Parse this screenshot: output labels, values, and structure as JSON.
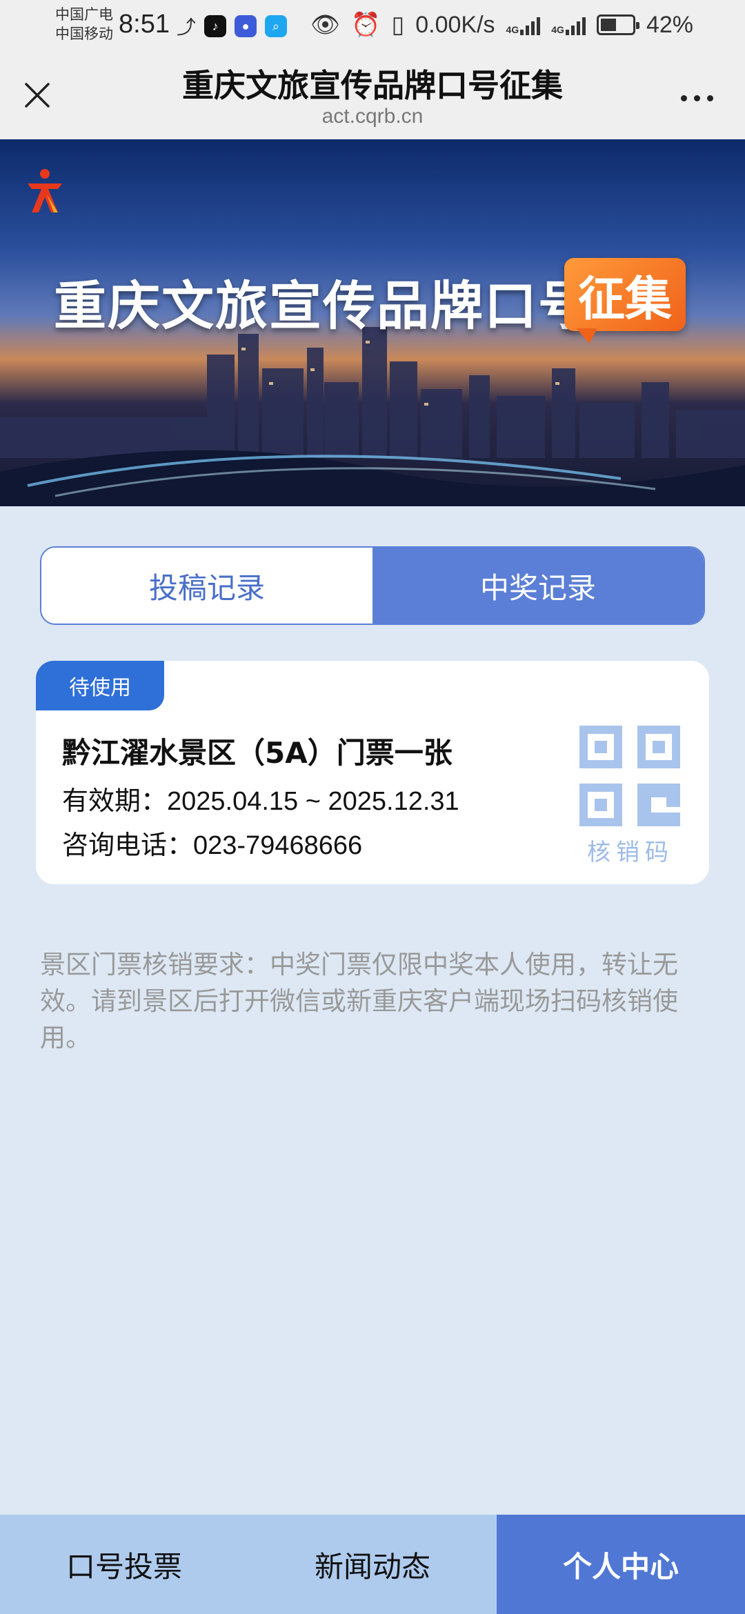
{
  "status_bar": {
    "carrier_1": "中国广电",
    "carrier_2": "中国移动",
    "time": "8:51",
    "net_speed": "0.00K/s",
    "signal_1_label": "4G",
    "signal_2_label": "4G",
    "battery": "42%",
    "icons": [
      "missed-call-icon",
      "tiktok-icon",
      "qq-icon",
      "search-app-icon",
      "eye-icon",
      "alarm-icon",
      "vibrate-icon"
    ]
  },
  "titlebar": {
    "title": "重庆文旅宣传品牌口号征集",
    "url": "act.cqrb.cn"
  },
  "banner": {
    "headline": "重庆文旅宣传品牌口号",
    "badge": "征集"
  },
  "tabs": [
    {
      "label": "投稿记录",
      "active": false
    },
    {
      "label": "中奖记录",
      "active": true
    }
  ],
  "prize_card": {
    "status": "待使用",
    "prize": "黔江濯水景区（5A）门票一张",
    "validity": "有效期：2025.04.15 ~ 2025.12.31",
    "phone": "咨询电话：023-79468666",
    "qr_label": "核销码"
  },
  "notice": "景区门票核销要求：中奖门票仅限中奖本人使用，转让无效。请到景区后打开微信或新重庆客户端现场扫码核销使用。",
  "bottom_nav": [
    {
      "label": "口号投票",
      "active": false
    },
    {
      "label": "新闻动态",
      "active": false
    },
    {
      "label": "个人中心",
      "active": true
    }
  ],
  "colors": {
    "accent": "#5b7fd6",
    "status_badge": "#2f6fd8",
    "page_bg": "#dde8f4",
    "nav_bg": "#aecbee",
    "nav_active": "#5077d4",
    "banner_badge": "#f0621a"
  }
}
